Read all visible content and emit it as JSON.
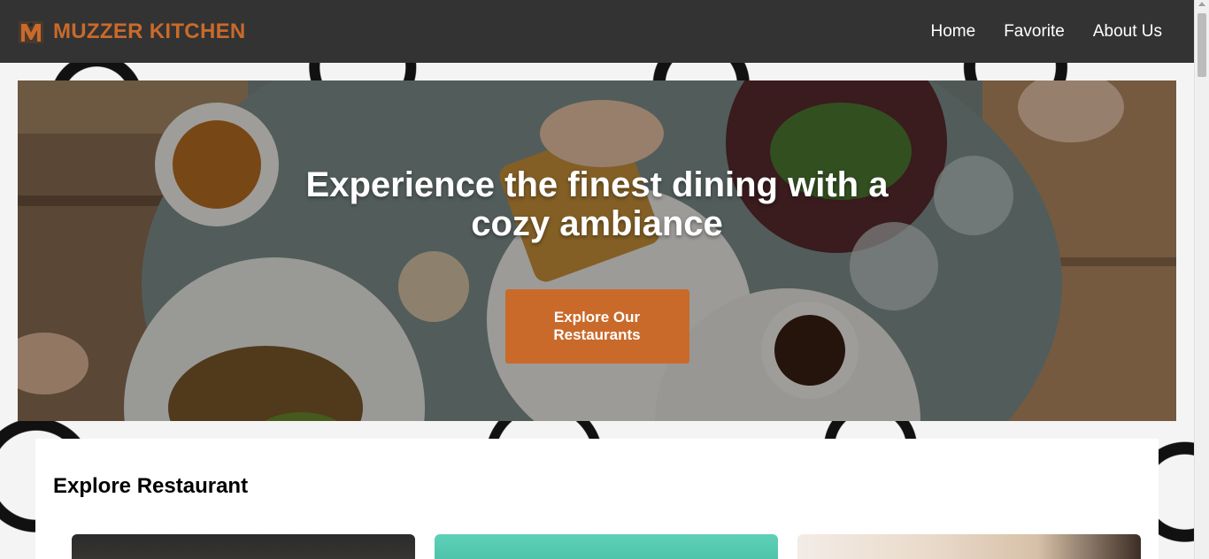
{
  "header": {
    "brand_name": "MUZZER KITCHEN",
    "logo_icon": "m-logo-icon",
    "nav": [
      {
        "label": "Home"
      },
      {
        "label": "Favorite"
      },
      {
        "label": "About Us"
      }
    ]
  },
  "hero": {
    "title": "Experience the finest dining with a cozy ambiance",
    "button_label": "Explore Our Restaurants"
  },
  "explore": {
    "title": "Explore Restaurant",
    "cards": [
      {
        "image": "restaurant-image-1"
      },
      {
        "image": "restaurant-image-2"
      },
      {
        "image": "restaurant-image-3"
      }
    ]
  },
  "colors": {
    "header_bg": "#333333",
    "brand_accent": "#c96a2b",
    "button_bg": "#c96a2b"
  }
}
